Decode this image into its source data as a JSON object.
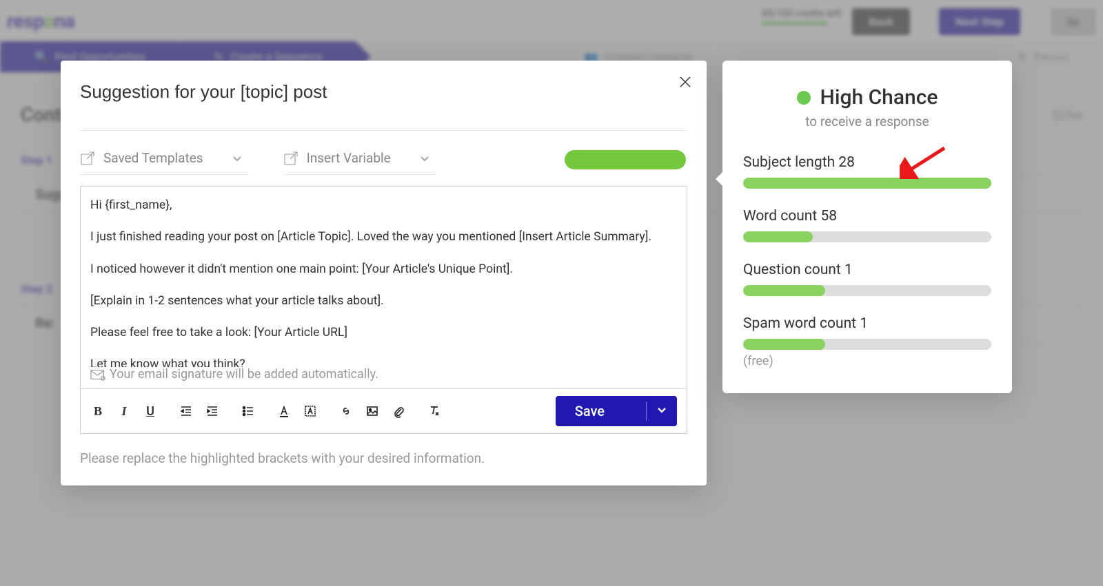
{
  "header": {
    "logo_text": "respona",
    "credits": "85/100 credits left",
    "back": "Back",
    "next": "Next Step",
    "settings_short": "Se"
  },
  "tabs": {
    "opportunities": "Find Opportunities",
    "sequence": "Create a Sequence",
    "contacts": "Connect Contacts",
    "personalize": "Person"
  },
  "bg": {
    "section_title": "Content Promotion",
    "step1": "Step 1",
    "step1_box": "Suggestion for your [topic] post",
    "step2": "Step 2",
    "step2_box": "Re:",
    "schedule": "Sche"
  },
  "modal": {
    "subject": "Suggestion for your [topic] post",
    "saved_templates": "Saved Templates",
    "insert_variable": "Insert Variable",
    "body": {
      "p1": "Hi {first_name},",
      "p2": "I just finished reading your post on [Article Topic]. Loved the way you mentioned [Insert Article Summary].",
      "p3": "I noticed however it didn't mention one main point: [Your Article's Unique Point].",
      "p4": "[Explain in 1-2 sentences what your article talks about].",
      "p5": "Please feel free to take a look: [Your Article URL]",
      "p6": "Let me know what you think?"
    },
    "signature_notice": "Your email signature will be added automatically.",
    "save": "Save",
    "hint": "Please replace the highlighted brackets with your desired information."
  },
  "panel": {
    "chance_title": "High Chance",
    "chance_sub": "to receive a response",
    "metrics": [
      {
        "label": "Subject length 28",
        "fill": 100,
        "note": ""
      },
      {
        "label": "Word count 58",
        "fill": 28,
        "note": ""
      },
      {
        "label": "Question count 1",
        "fill": 33,
        "note": ""
      },
      {
        "label": "Spam word count 1",
        "fill": 33,
        "note": "(free)"
      }
    ]
  }
}
